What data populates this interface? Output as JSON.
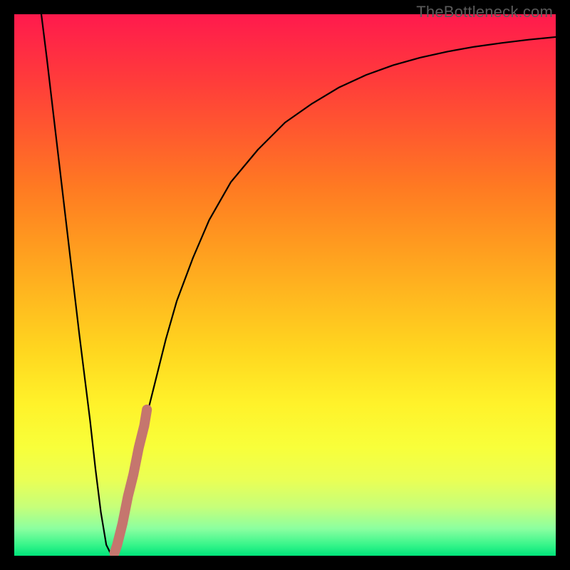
{
  "watermark": "TheBottleneck.com",
  "colors": {
    "curve_stroke": "#000000",
    "highlight_stroke": "#c5766e",
    "gradient_top": "#ff1a4d",
    "gradient_bottom": "#00e47a",
    "frame_bg": "#000000"
  },
  "chart_data": {
    "type": "line",
    "title": "",
    "xlabel": "",
    "ylabel": "",
    "xlim": [
      0,
      100
    ],
    "ylim": [
      0,
      100
    ],
    "grid": false,
    "legend": false,
    "series": [
      {
        "name": "bottleneck-curve",
        "x": [
          5,
          6,
          8,
          10,
          12,
          13,
          14,
          15,
          16,
          17,
          18,
          20,
          22,
          24,
          26,
          28,
          30,
          33,
          36,
          40,
          45,
          50,
          55,
          60,
          65,
          70,
          75,
          80,
          85,
          90,
          95,
          100
        ],
        "values": [
          100,
          92,
          75,
          58,
          41,
          33,
          25,
          16,
          8,
          2,
          0,
          6,
          15,
          24,
          32,
          40,
          47,
          55,
          62,
          69,
          75,
          80,
          83.5,
          86.5,
          88.8,
          90.6,
          92,
          93.1,
          94,
          94.7,
          95.3,
          95.8
        ]
      },
      {
        "name": "optimal-range-highlight",
        "x": [
          18.5,
          19,
          20,
          21,
          22,
          23,
          24,
          24.5
        ],
        "values": [
          0.5,
          2,
          6,
          11,
          15,
          20,
          24,
          27
        ]
      }
    ],
    "annotations": []
  }
}
